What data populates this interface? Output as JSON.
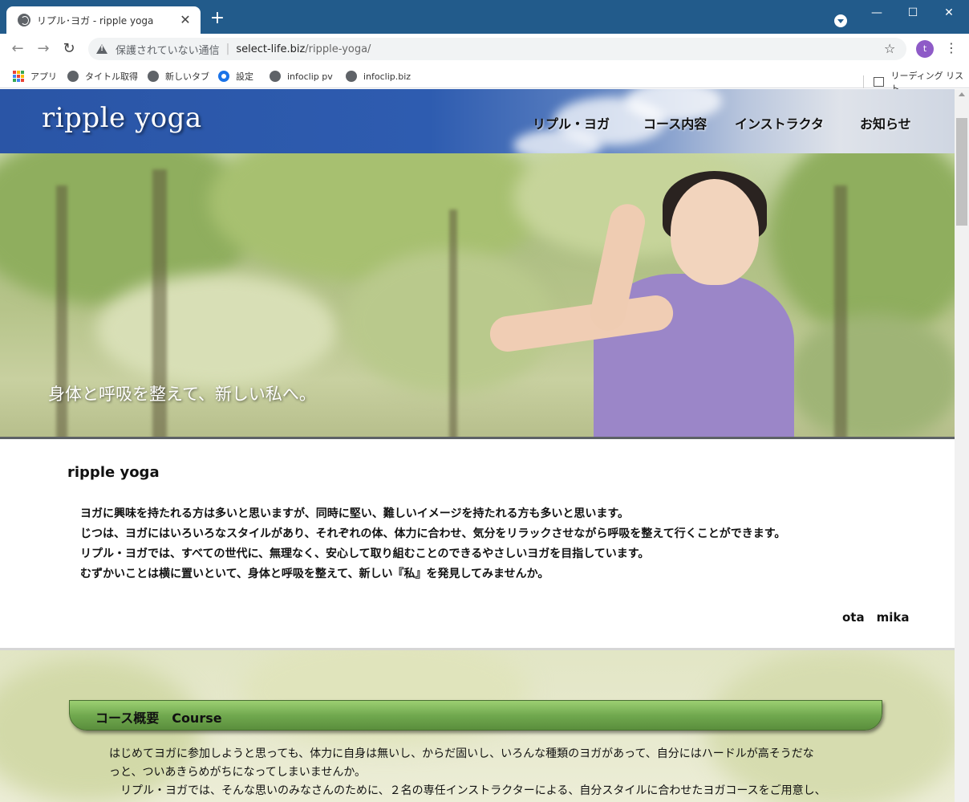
{
  "browser": {
    "tab_title": "リプル･ヨガ - ripple yoga",
    "tab_close": "✕",
    "new_tab": "+",
    "window_controls": {
      "minimize": "—",
      "maximize": "☐",
      "close": "✕"
    },
    "nav": {
      "back": "←",
      "forward": "→",
      "reload": "↻"
    },
    "address": {
      "security_status": "保護されていない通信",
      "host": "select-life.biz",
      "path": "/ripple-yoga/"
    },
    "star": "☆",
    "profile_initial": "t",
    "menu": "⋮",
    "bookmarks": [
      {
        "label": "アプリ",
        "icon": "apps-icon"
      },
      {
        "label": "タイトル取得",
        "icon": "globe-icon"
      },
      {
        "label": "新しいタブ",
        "icon": "globe-icon"
      },
      {
        "label": "設定",
        "icon": "gear-icon"
      },
      {
        "label": "infoclip pv",
        "icon": "globe-icon"
      },
      {
        "label": "infoclip.biz",
        "icon": "globe-icon"
      }
    ],
    "reading_list": "リーディング リスト"
  },
  "site": {
    "logo": "ripple yoga",
    "nav": [
      "リプル・ヨガ",
      "コース内容",
      "インストラクタ",
      "お知らせ"
    ],
    "hero_tagline": "身体と呼吸を整えて、新しい私へ。",
    "intro": {
      "title": "ripple yoga",
      "paragraphs": [
        "ヨガに興味を持たれる方は多いと思いますが、同時に堅い、難しいイメージを持たれる方も多いと思います。",
        "じつは、ヨガにはいろいろなスタイルがあり、それぞれの体、体力に合わせ、気分をリラックさせながら呼吸を整えて行くことができます。",
        "リプル・ヨガでは、すべての世代に、無理なく、安心して取り組むことのできるやさしいヨガを目指しています。",
        "むずかいことは横に置いといて、身体と呼吸を整えて、新しい『私』を発見してみませんか。"
      ],
      "signature": "ota　mika"
    },
    "course": {
      "heading": "コース概要　Course",
      "paragraphs": [
        "はじめてヨガに参加しようと思っても、体力に自身は無いし、からだ固いし、いろんな種類のヨガがあって、自分にはハードルが高そうだな",
        "っと、ついあきらめがちになってしまいませんか。",
        "　リプル・ヨガでは、そんな思いのみなさんのために、２名の専任インストラクターによる、自分スタイルに合わせたヨガコースをご用意し、"
      ]
    }
  },
  "colors": {
    "tabbar": "#225b8b",
    "header_blue": "#2a55a6",
    "course_bar_green": "#71a94f",
    "shirt_purple": "#9b86c8"
  }
}
